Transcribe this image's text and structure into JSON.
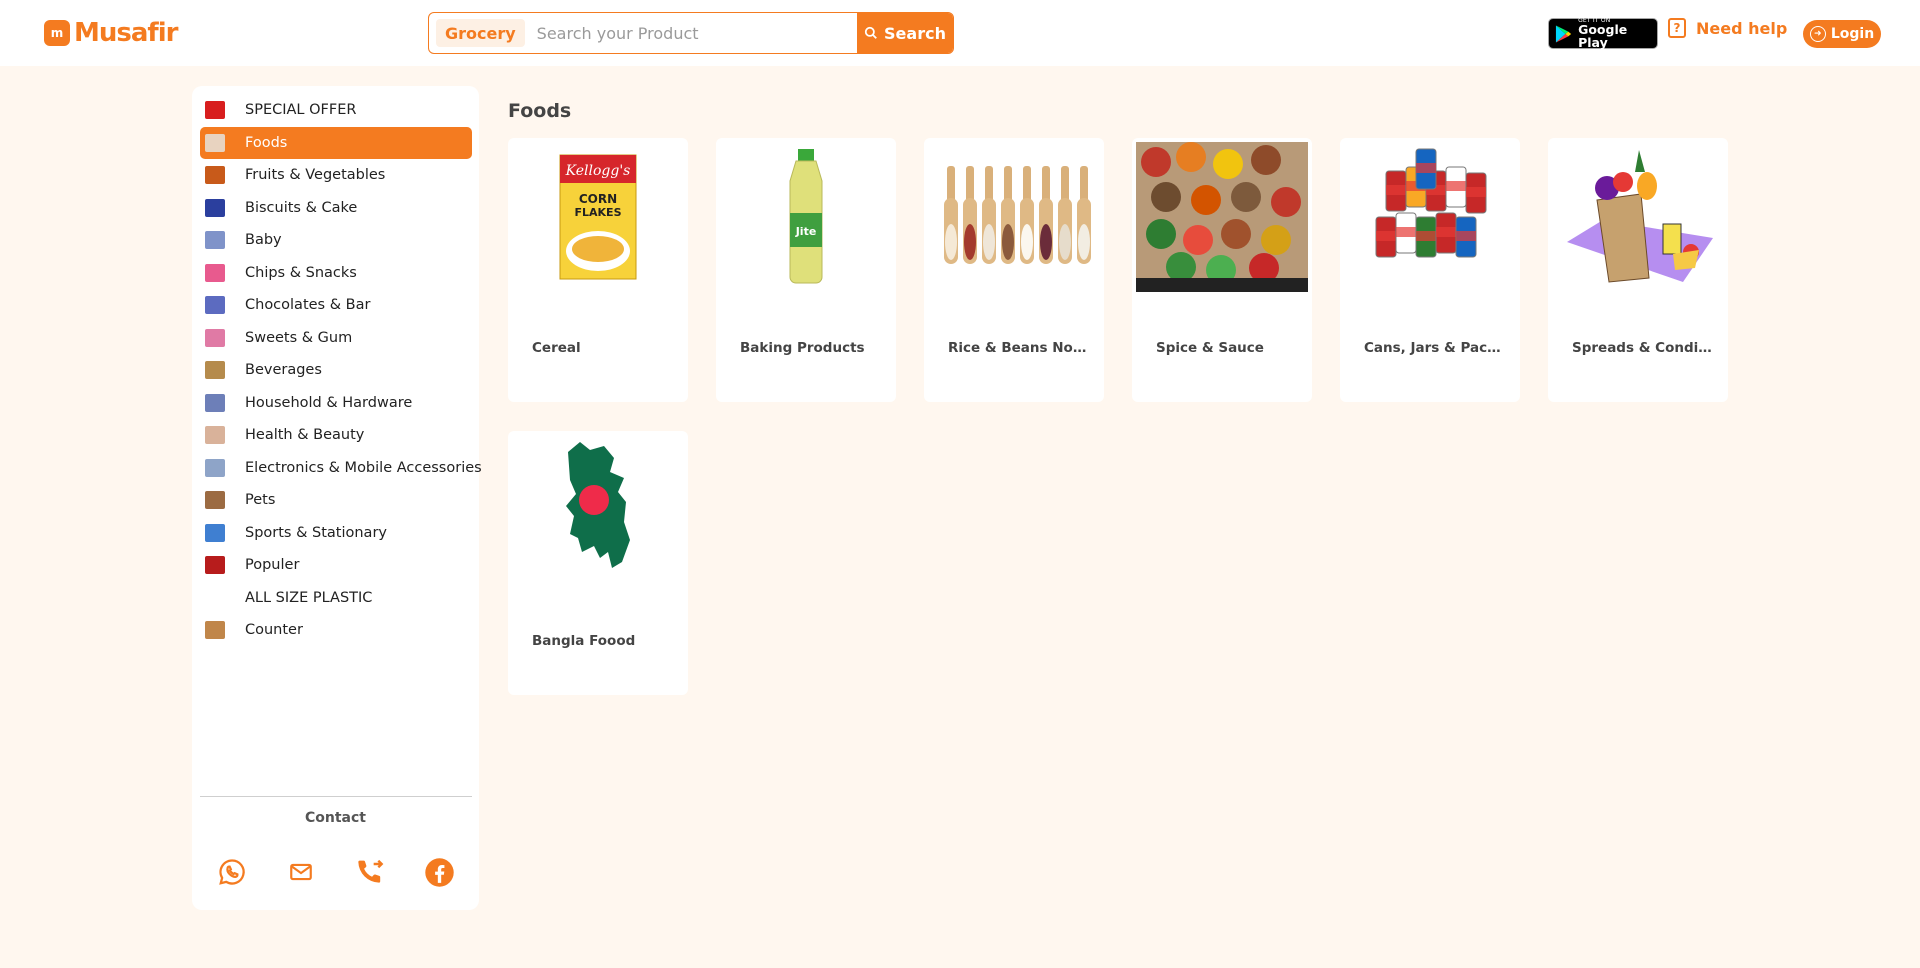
{
  "header": {
    "logo_text": "Musafir",
    "logo_mark": "m",
    "search": {
      "category": "Grocery",
      "placeholder": "Search your Product",
      "button_label": "Search"
    },
    "google_play": {
      "small": "GET IT ON",
      "big": "Google Play"
    },
    "need_help": "Need help",
    "login": "Login"
  },
  "sidebar": {
    "items": [
      {
        "label": "SPECIAL OFFER",
        "active": false,
        "thumb_color": "#d81e1e"
      },
      {
        "label": "Foods",
        "active": true,
        "thumb_color": "#e8d3c0"
      },
      {
        "label": "Fruits & Vegetables",
        "active": false,
        "thumb_color": "#c85a1a"
      },
      {
        "label": "Biscuits & Cake",
        "active": false,
        "thumb_color": "#2b3f9e"
      },
      {
        "label": "Baby",
        "active": false,
        "thumb_color": "#7f93c9"
      },
      {
        "label": "Chips & Snacks",
        "active": false,
        "thumb_color": "#e85a8e"
      },
      {
        "label": "Chocolates & Bar",
        "active": false,
        "thumb_color": "#5c6bc0"
      },
      {
        "label": "Sweets & Gum",
        "active": false,
        "thumb_color": "#e07aa5"
      },
      {
        "label": "Beverages",
        "active": false,
        "thumb_color": "#b58b4c"
      },
      {
        "label": "Household & Hardware",
        "active": false,
        "thumb_color": "#6d7fb8"
      },
      {
        "label": "Health & Beauty",
        "active": false,
        "thumb_color": "#d9b29a"
      },
      {
        "label": "Electronics & Mobile Accessories",
        "active": false,
        "thumb_color": "#8ea4c8"
      },
      {
        "label": "Pets",
        "active": false,
        "thumb_color": "#9c6b42"
      },
      {
        "label": "Sports & Stationary",
        "active": false,
        "thumb_color": "#3f7fd1"
      },
      {
        "label": "Populer",
        "active": false,
        "thumb_color": "#b71c1c"
      },
      {
        "label": "ALL SIZE PLASTIC",
        "active": false,
        "thumb_color": "transparent"
      },
      {
        "label": "Counter",
        "active": false,
        "thumb_color": "#c0864a"
      }
    ],
    "contact_title": "Contact"
  },
  "main": {
    "title": "Foods",
    "cards": [
      {
        "label": "Cereal",
        "art": "cereal-box"
      },
      {
        "label": "Baking Products",
        "art": "oil-bottle"
      },
      {
        "label": "Rice & Beans Noo...",
        "art": "scoops"
      },
      {
        "label": "Spice & Sauce",
        "art": "spices"
      },
      {
        "label": "Cans, Jars & Pack...",
        "art": "cans"
      },
      {
        "label": "Spreads & Condi...",
        "art": "grocery-bag"
      },
      {
        "label": "Bangla Foood",
        "art": "bangladesh-map"
      }
    ]
  },
  "colors": {
    "accent": "#f47b20",
    "page_bg": "#fff7ef"
  }
}
